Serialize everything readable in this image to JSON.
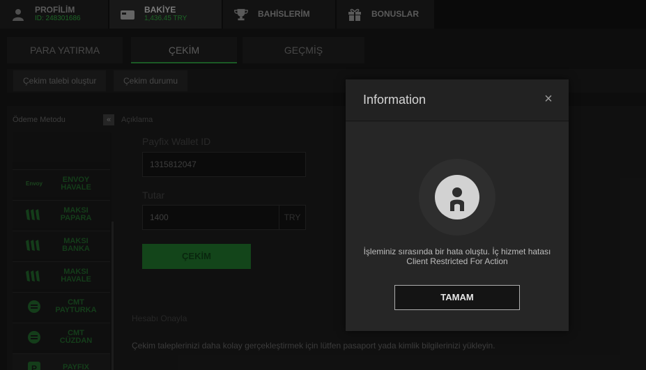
{
  "topnav": {
    "items": [
      {
        "label": "PROFİLİM",
        "sub": "ID: 248301686",
        "icon": "user-icon"
      },
      {
        "label": "BAKİYE",
        "sub": "1,436.45 TRY",
        "icon": "wallet-icon"
      },
      {
        "label": "BAHİSLERİM",
        "icon": "trophy-icon"
      },
      {
        "label": "BONUSLAR",
        "icon": "gift-icon"
      }
    ]
  },
  "tabs": [
    "PARA YATIRMA",
    "ÇEKİM",
    "GEÇMİŞ"
  ],
  "subtabs": [
    "Çekim talebi oluştur",
    "Çekim durumu"
  ],
  "sidebar": {
    "title": "Ödeme Metodu",
    "collapse_glyph": "«",
    "methods": [
      {
        "name_1": "ENVOY",
        "name_2": "HAVALE",
        "logo_text": "Envoy"
      },
      {
        "name_1": "MAKSI",
        "name_2": "PAPARA"
      },
      {
        "name_1": "MAKSI",
        "name_2": "BANKA"
      },
      {
        "name_1": "MAKSI",
        "name_2": "HAVALE"
      },
      {
        "name_1": "CMT",
        "name_2": "PAYTURKA"
      },
      {
        "name_1": "CMT",
        "name_2": "CÜZDAN"
      },
      {
        "name_1": "PAYFIX",
        "name_2": ""
      }
    ]
  },
  "description_title": "Açıklama",
  "form": {
    "wallet_label": "Payfix Wallet ID",
    "wallet_value": "1315812047",
    "amount_label": "Tutar",
    "amount_value": "1400",
    "currency": "TRY",
    "submit_label": "ÇEKİM"
  },
  "verify": {
    "title": "Hesabı Onayla",
    "text": "Çekim taleplerinizi daha kolay gerçekleştirmek için lütfen pasaport yada kimlik bilgilerinizi yükleyin."
  },
  "modal": {
    "title": "Information",
    "close_glyph": "×",
    "message": "İşleminiz sırasında bir hata oluştu. İç hizmet hatası Client Restricted For Action",
    "button_label": "TAMAM"
  },
  "colors": {
    "accent_green": "#2a8b3a",
    "background": "#141414",
    "modal_bg": "#262626"
  }
}
